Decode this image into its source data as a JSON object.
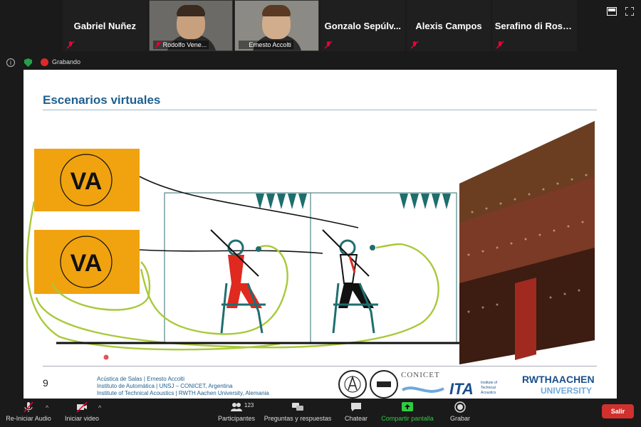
{
  "participants": [
    {
      "name": "Gabriel Nuñez",
      "video": false
    },
    {
      "name": "Rodolfo Vene...",
      "video": true
    },
    {
      "name": "Ernesto Accolti",
      "video": true
    },
    {
      "name": "Gonzalo Sepúlv...",
      "video": false
    },
    {
      "name": "Alexis Campos",
      "video": false
    },
    {
      "name": "Serafino di Rosa...",
      "video": false
    }
  ],
  "view_icons": [
    "speaker-view-icon",
    "fullscreen-icon"
  ],
  "recording": {
    "label": "Grabando"
  },
  "slide": {
    "title": "Escenarios virtuales",
    "page_number": "9",
    "logo_text": "VA",
    "credits": [
      "Acústica de Salas | Ernesto Accolti",
      "Instituto de Automática | UNSJ – CONICET, Argentina",
      "Institute of Technical Acoustics | RWTH Aachen University, Alemania"
    ],
    "logos": {
      "conicet": "CONICET",
      "ita": "ITA",
      "ita_sub": [
        "Institute of",
        "Technical",
        "Acoustics"
      ],
      "rwth_top": "RWTHAACHEN",
      "rwth_bottom": "UNIVERSITY"
    },
    "colors": {
      "accent_title": "#1f5f8f",
      "va_box": "#f0a30f",
      "cable_green": "#a8c93a",
      "bunting": "#1f6e6e",
      "red_player": "#e0291f"
    }
  },
  "toolbar": {
    "audio": "Re-Iniciar Audio",
    "video": "Iniciar video",
    "participants": "Participantes",
    "participants_count": "123",
    "qa": "Preguntas y respuestas",
    "chat": "Chatear",
    "share": "Compartir pantalla",
    "record": "Grabar",
    "leave": "Salir"
  }
}
